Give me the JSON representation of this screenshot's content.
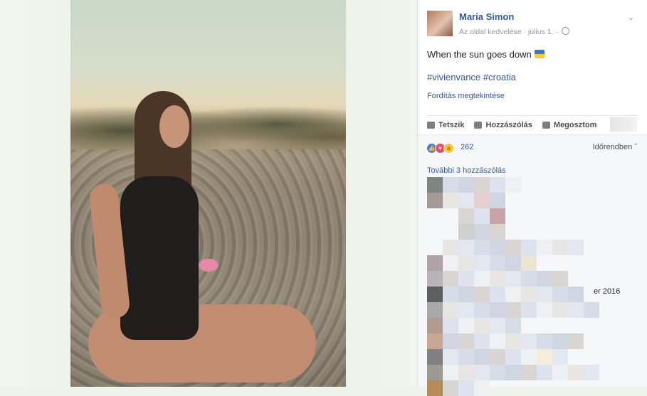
{
  "post": {
    "author": "Maria Simon",
    "meta_like": "Az oldal kedvelése",
    "meta_sep": "·",
    "date": "július 1.",
    "caption": "When the sun goes down",
    "hashtags": "#vivienvance #croatia",
    "translate": "Fordítás megtekintése"
  },
  "actions": {
    "like": "Tetszik",
    "comment": "Hozzászólás",
    "share": "Megosztom"
  },
  "reactions": {
    "count": "262",
    "order": "Időrendben ˇ"
  },
  "comments": {
    "more": "További 3 hozzászólás",
    "partial_text": "er 2016"
  },
  "colors": {
    "link": "#365899",
    "muted": "#90949c"
  },
  "icons": [
    "chevron-down-icon",
    "globe-icon",
    "flag-icon",
    "like-icon",
    "comment-icon",
    "share-icon",
    "reaction-like-icon",
    "reaction-love-icon",
    "reaction-wow-icon"
  ]
}
